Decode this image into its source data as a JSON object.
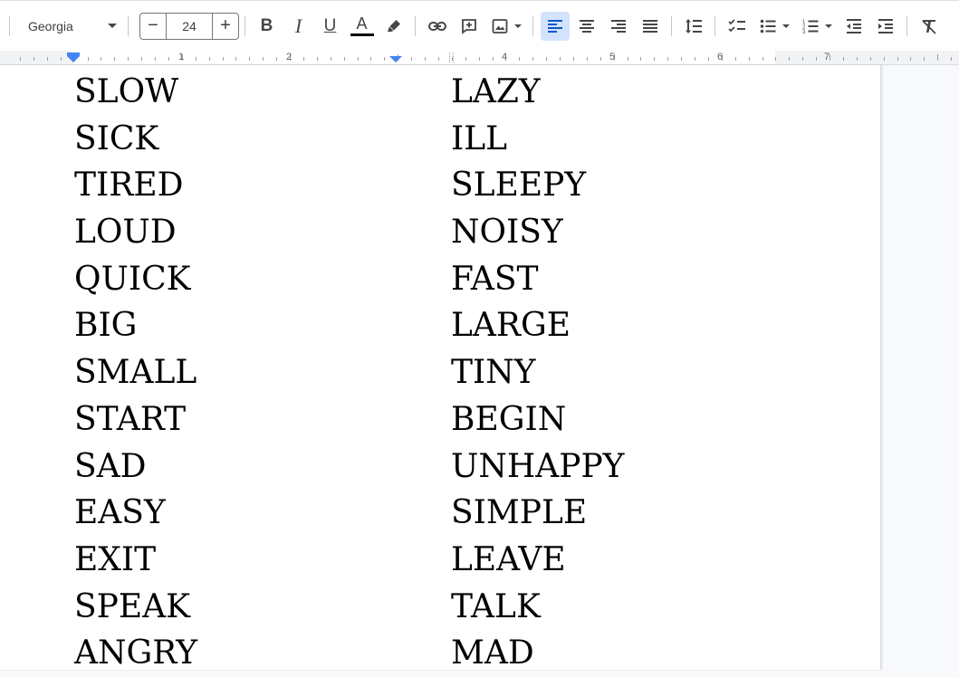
{
  "toolbar": {
    "font_name": "Georgia",
    "font_size": "24",
    "minus_label": "−",
    "plus_label": "+",
    "bold_glyph": "B",
    "italic_glyph": "I",
    "underline_glyph": "U",
    "text_color_glyph": "A",
    "text_color": "#000000",
    "active_align": "left",
    "accent_color": "#d3e3fd",
    "icons": [
      "link-icon",
      "add-comment-icon",
      "insert-image-icon",
      "align-left-icon",
      "align-center-icon",
      "align-right-icon",
      "align-justify-icon",
      "line-spacing-icon",
      "checklist-icon",
      "bulleted-list-icon",
      "numbered-list-icon",
      "decrease-indent-icon",
      "increase-indent-icon",
      "clear-formatting-icon"
    ]
  },
  "ruler": {
    "numbers": [
      "1",
      "2",
      "4",
      "5",
      "6",
      "7"
    ]
  },
  "document": {
    "left_column": [
      "SLOW",
      "SICK",
      "TIRED",
      "LOUD",
      "QUICK",
      "BIG",
      "SMALL",
      "START",
      "SAD",
      "EASY",
      "EXIT",
      "SPEAK",
      "ANGRY"
    ],
    "right_column": [
      "LAZY",
      "ILL",
      "SLEEPY",
      "NOISY",
      "FAST",
      "LARGE",
      "TINY",
      "BEGIN",
      "UNHAPPY",
      "SIMPLE",
      "LEAVE",
      "TALK",
      "MAD"
    ]
  }
}
